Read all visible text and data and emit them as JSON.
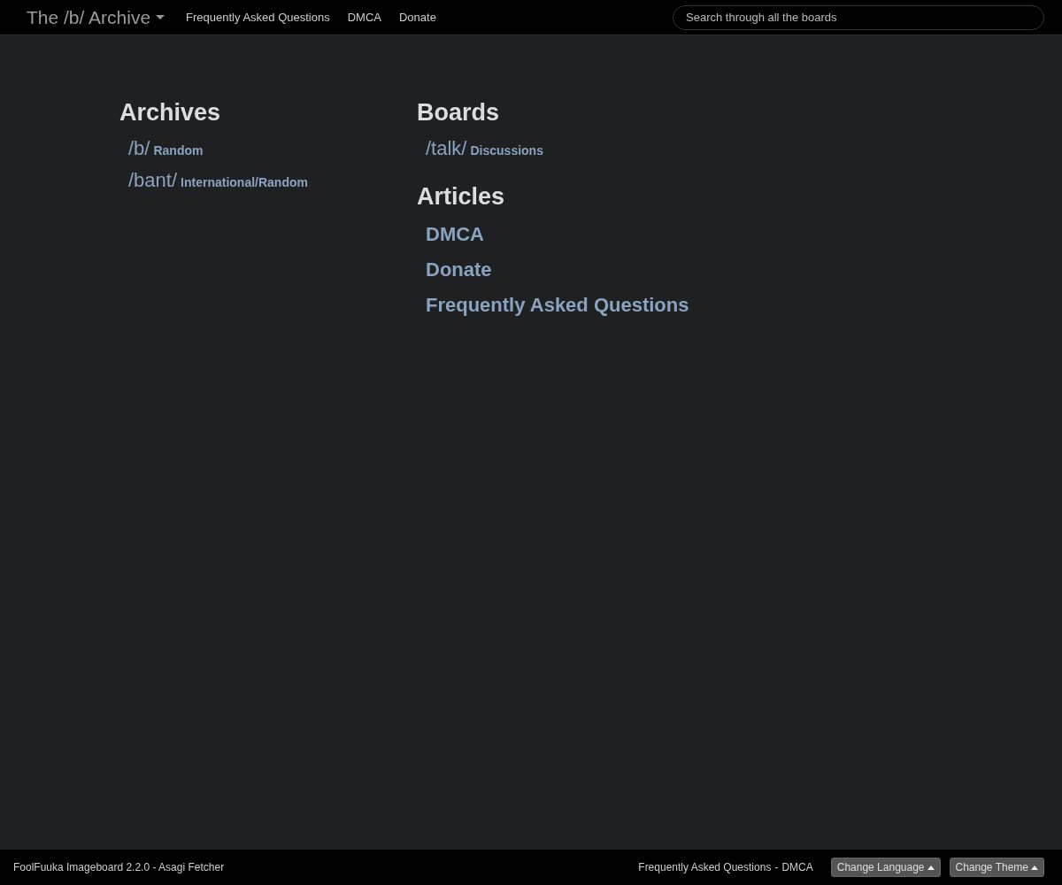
{
  "navbar": {
    "brand": "The /b/ Archive",
    "links": [
      "Frequently Asked Questions",
      "DMCA",
      "Donate"
    ],
    "search": {
      "placeholder": "Search through all the boards"
    }
  },
  "columns": [
    {
      "sections": [
        {
          "title": "Archives",
          "kind": "boards",
          "items": [
            {
              "code": "/b/",
              "name": "Random"
            },
            {
              "code": "/bant/",
              "name": "International/Random"
            }
          ]
        }
      ]
    },
    {
      "sections": [
        {
          "title": "Boards",
          "kind": "boards",
          "items": [
            {
              "code": "/talk/",
              "name": "Discussions"
            }
          ]
        },
        {
          "title": "Articles",
          "kind": "articles",
          "items": [
            {
              "name": "DMCA"
            },
            {
              "name": "Donate"
            },
            {
              "name": "Frequently Asked Questions"
            }
          ]
        }
      ]
    }
  ],
  "footer": {
    "credit": "FoolFuuka Imageboard 2.2.0 - Asagi Fetcher",
    "links": [
      "Frequently Asked Questions",
      "DMCA"
    ],
    "separator": "-",
    "buttons": [
      "Change Language",
      "Change Theme"
    ]
  }
}
